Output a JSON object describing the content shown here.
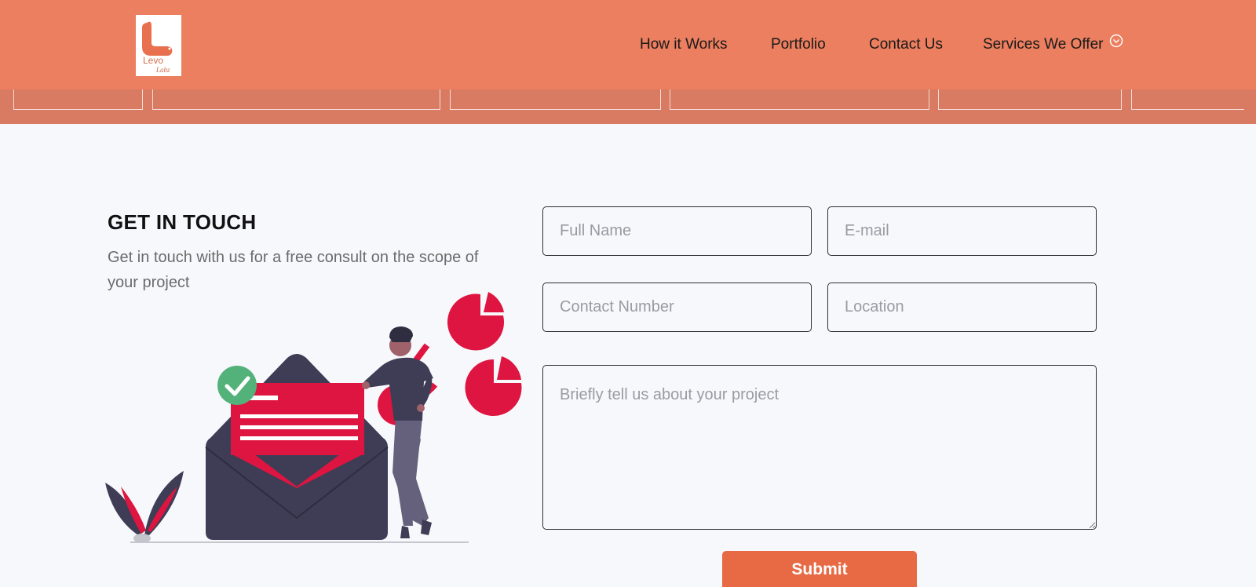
{
  "header": {
    "logo_alt": "Levo Labz",
    "nav": [
      {
        "label": "How it Works"
      },
      {
        "label": "Portfolio"
      },
      {
        "label": "Contact Us"
      },
      {
        "label": "Services We Offer",
        "icon": "chevron-down-circle-icon"
      }
    ]
  },
  "contact": {
    "title": "GET IN TOUCH",
    "subtitle": "Get in touch with us for a free consult on the scope of your project"
  },
  "form": {
    "full_name": {
      "placeholder": "Full Name",
      "value": ""
    },
    "email": {
      "placeholder": "E-mail",
      "value": ""
    },
    "contact_number": {
      "placeholder": "Contact Number",
      "value": ""
    },
    "location": {
      "placeholder": "Location",
      "value": ""
    },
    "project": {
      "placeholder": "Briefly tell us about your project",
      "value": ""
    },
    "submit_label": "Submit"
  },
  "colors": {
    "header_bg": "#ec7f5f",
    "strip_bg": "#d97a62",
    "accent": "#e76a45",
    "illustration_red": "#de1540",
    "illustration_dark": "#3f3d56",
    "check_green": "#53b27a"
  }
}
